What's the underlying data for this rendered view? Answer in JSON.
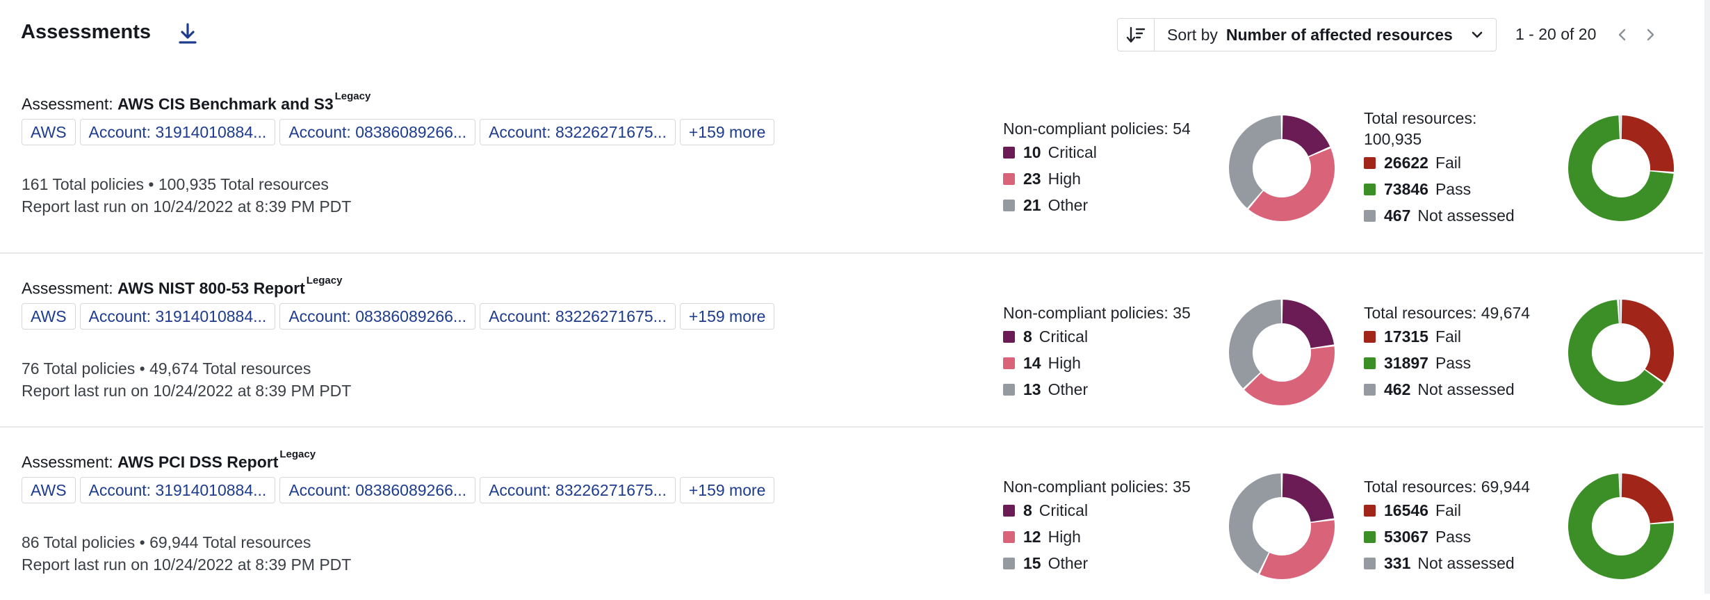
{
  "header": {
    "title": "Assessments",
    "sort_prefix": "Sort by",
    "sort_value": "Number of affected resources",
    "pagination": "1 - 20 of 20"
  },
  "colors": {
    "critical": "#6b1c55",
    "high": "#d9647a",
    "other": "#959aa0",
    "fail": "#a12619",
    "pass": "#3c8f27",
    "not_assessed": "#959aa0",
    "link": "#1d3c8f"
  },
  "assessments": [
    {
      "prefix": "Assessment:",
      "name": "AWS CIS Benchmark and S3",
      "badge": "Legacy",
      "tags": [
        "AWS",
        "Account: 31914010884...",
        "Account: 08386089266...",
        "Account: 83226271675...",
        "+159 more"
      ],
      "stats": "161 Total policies • 100,935 Total resources",
      "last_run": "Report last run on 10/24/2022 at 8:39 PM PDT",
      "policies": {
        "header": "Non-compliant policies: 54",
        "items": [
          {
            "value": "10",
            "label": "Critical"
          },
          {
            "value": "23",
            "label": "High"
          },
          {
            "value": "21",
            "label": "Other"
          }
        ]
      },
      "resources": {
        "header_line1": "Total resources:",
        "header_line2": "100,935",
        "items": [
          {
            "value": "26622",
            "label": "Fail"
          },
          {
            "value": "73846",
            "label": "Pass"
          },
          {
            "value": "467",
            "label": "Not assessed"
          }
        ]
      }
    },
    {
      "prefix": "Assessment:",
      "name": "AWS NIST 800-53 Report",
      "badge": "Legacy",
      "tags": [
        "AWS",
        "Account: 31914010884...",
        "Account: 08386089266...",
        "Account: 83226271675...",
        "+159 more"
      ],
      "stats": "76 Total policies • 49,674 Total resources",
      "last_run": "Report last run on 10/24/2022 at 8:39 PM PDT",
      "policies": {
        "header": "Non-compliant policies: 35",
        "items": [
          {
            "value": "8",
            "label": "Critical"
          },
          {
            "value": "14",
            "label": "High"
          },
          {
            "value": "13",
            "label": "Other"
          }
        ]
      },
      "resources": {
        "header_line1": "Total resources: 49,674",
        "header_line2": "",
        "items": [
          {
            "value": "17315",
            "label": "Fail"
          },
          {
            "value": "31897",
            "label": "Pass"
          },
          {
            "value": "462",
            "label": "Not assessed"
          }
        ]
      }
    },
    {
      "prefix": "Assessment:",
      "name": "AWS PCI DSS Report",
      "badge": "Legacy",
      "tags": [
        "AWS",
        "Account: 31914010884...",
        "Account: 08386089266...",
        "Account: 83226271675...",
        "+159 more"
      ],
      "stats": "86 Total policies • 69,944 Total resources",
      "last_run": "Report last run on 10/24/2022 at 8:39 PM PDT",
      "policies": {
        "header": "Non-compliant policies: 35",
        "items": [
          {
            "value": "8",
            "label": "Critical"
          },
          {
            "value": "12",
            "label": "High"
          },
          {
            "value": "15",
            "label": "Other"
          }
        ]
      },
      "resources": {
        "header_line1": "Total resources: 69,944",
        "header_line2": "",
        "items": [
          {
            "value": "16546",
            "label": "Fail"
          },
          {
            "value": "53067",
            "label": "Pass"
          },
          {
            "value": "331",
            "label": "Not assessed"
          }
        ]
      }
    }
  ]
}
